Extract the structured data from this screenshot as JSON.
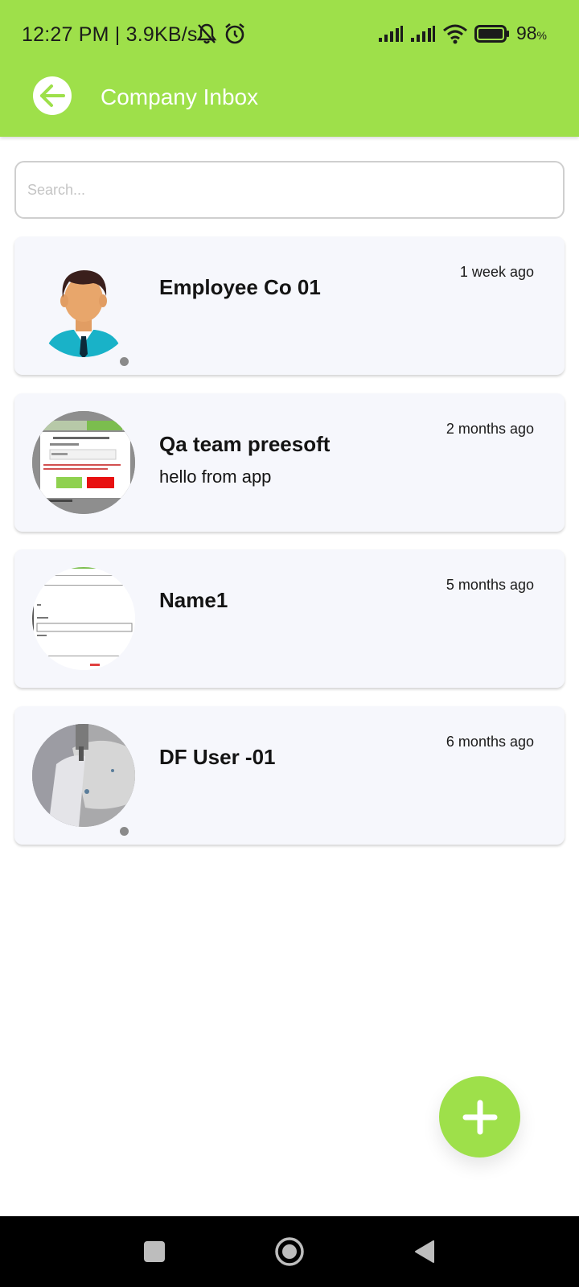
{
  "status_bar": {
    "time_speed": "12:27 PM | 3.9KB/s",
    "battery_percent": "98",
    "battery_unit": "%",
    "icons": [
      "mute-bell-icon",
      "alarm-icon",
      "signal-icon",
      "signal-icon",
      "wifi-icon",
      "battery-icon"
    ]
  },
  "app_bar": {
    "title": "Company Inbox",
    "back_icon": "arrow-left-icon"
  },
  "search": {
    "placeholder": "Search..."
  },
  "chats": [
    {
      "name": "Employee Co 01",
      "message": "",
      "time": "1 week ago",
      "avatar": "employee-illustration",
      "status_dot": true
    },
    {
      "name": "Qa team preesoft",
      "message": "hello from app",
      "time": "2 months ago",
      "avatar": "screenshot-photo",
      "status_dot": false
    },
    {
      "name": "Name1",
      "message": "",
      "time": "5 months ago",
      "avatar": "form-photo",
      "status_dot": false
    },
    {
      "name": "DF User -01",
      "message": "",
      "time": "6 months ago",
      "avatar": "fabric-photo",
      "status_dot": true
    }
  ],
  "fab": {
    "icon": "plus-icon"
  },
  "nav_bar": {
    "icons": [
      "recents-square-icon",
      "home-circle-icon",
      "back-triangle-icon"
    ]
  },
  "colors": {
    "accent": "#9ee04a",
    "card_bg": "#f6f7fc",
    "status_dot": "#8a8a8a"
  }
}
